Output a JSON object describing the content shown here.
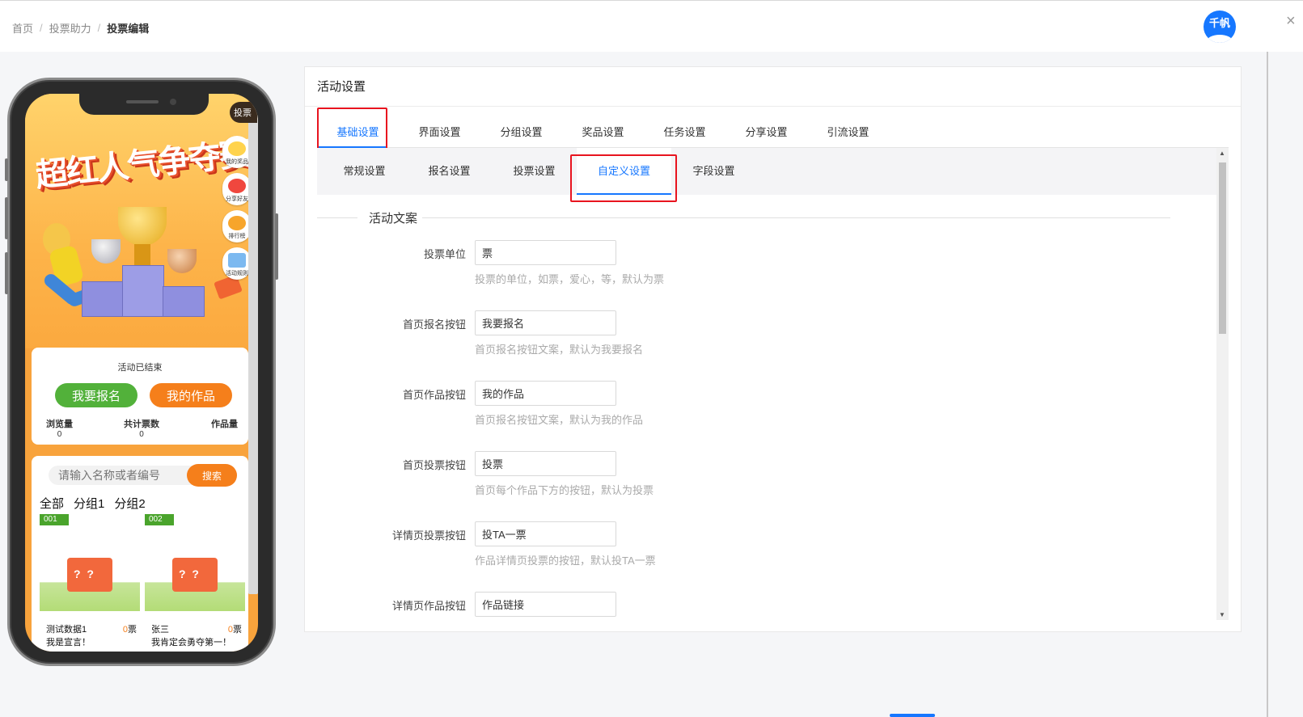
{
  "breadcrumb": {
    "items": [
      "首页",
      "投票助力"
    ],
    "current": "投票编辑"
  },
  "header": {
    "avatar_text": "千帆",
    "close_icon": "×"
  },
  "phone": {
    "vote_badge": "投票",
    "hero_title": "超红人气争夺赛",
    "side_buttons": [
      "我的奖品",
      "分享好友",
      "排行榜",
      "活动规则"
    ],
    "status": "活动已结束",
    "register_button": "我要报名",
    "my_works_button": "我的作品",
    "stats": [
      {
        "label": "浏览量",
        "value": "0"
      },
      {
        "label": "共计票数",
        "value": "0"
      },
      {
        "label": "作品量",
        "value": ""
      }
    ],
    "search_placeholder": "请输入名称或者编号",
    "search_button": "搜索",
    "group_tabs": [
      "全部",
      "分组1",
      "分组2"
    ],
    "entries": [
      {
        "number": "001",
        "name": "测试数据1",
        "votes": "0",
        "unit": "票",
        "motto": "我是宣言！"
      },
      {
        "number": "002",
        "name": "张三",
        "votes": "0",
        "unit": "票",
        "motto": "我肯定会勇夺第一！"
      }
    ]
  },
  "panel": {
    "title": "活动设置",
    "main_tabs": [
      "基础设置",
      "界面设置",
      "分组设置",
      "奖品设置",
      "任务设置",
      "分享设置",
      "引流设置"
    ],
    "sub_tabs": [
      "常规设置",
      "报名设置",
      "投票设置",
      "自定义设置",
      "字段设置"
    ],
    "section_title": "活动文案",
    "fields": [
      {
        "label": "投票单位",
        "value": "票",
        "hint": "投票的单位，如票，爱心，等，默认为票"
      },
      {
        "label": "首页报名按钮",
        "value": "我要报名",
        "hint": "首页报名按钮文案，默认为我要报名"
      },
      {
        "label": "首页作品按钮",
        "value": "我的作品",
        "hint": "首页报名按钮文案，默认为我的作品"
      },
      {
        "label": "首页投票按钮",
        "value": "投票",
        "hint": "首页每个作品下方的按钮，默认为投票"
      },
      {
        "label": "详情页投票按钮",
        "value": "投TA一票",
        "hint": "作品详情页投票的按钮，默认投TA一票"
      },
      {
        "label": "详情页作品按钮",
        "value": "作品链接",
        "hint": ""
      }
    ]
  },
  "colors": {
    "accent": "#1677ff",
    "highlight_red": "#e8141f",
    "green": "#52b13a",
    "orange": "#f57f1b"
  }
}
